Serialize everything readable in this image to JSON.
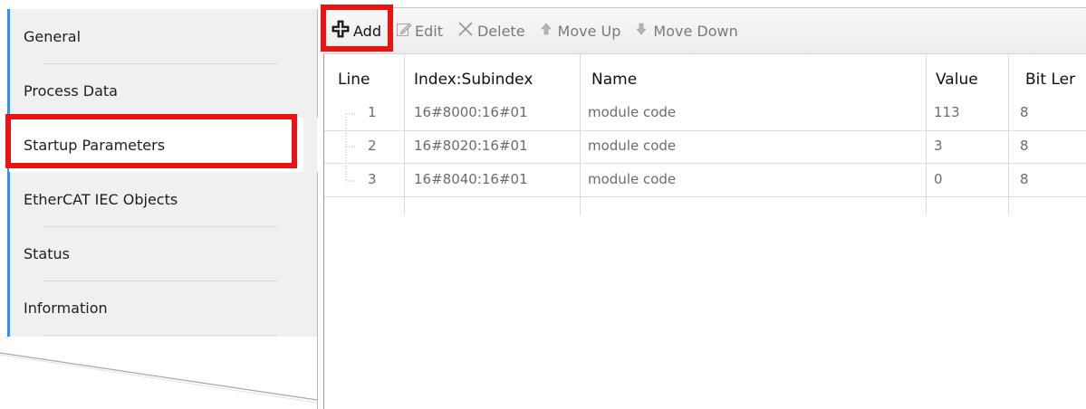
{
  "sidebar": {
    "items": [
      {
        "label": "General"
      },
      {
        "label": "Process Data"
      },
      {
        "label": "Startup Parameters"
      },
      {
        "label": "EtherCAT IEC Objects"
      },
      {
        "label": "Status"
      },
      {
        "label": "Information"
      }
    ],
    "active_index": 2
  },
  "toolbar": {
    "add_label": "Add",
    "edit_label": "Edit",
    "delete_label": "Delete",
    "move_up_label": "Move Up",
    "move_down_label": "Move Down"
  },
  "table": {
    "headers": [
      "Line",
      "Index:Subindex",
      "Name",
      "Value",
      "Bit Ler"
    ],
    "rows": [
      {
        "line": "1",
        "index": "16#8000:16#01",
        "name": "module code",
        "value": "113",
        "bitlen": "8"
      },
      {
        "line": "2",
        "index": "16#8020:16#01",
        "name": "module code",
        "value": "3",
        "bitlen": "8"
      },
      {
        "line": "3",
        "index": "16#8040:16#01",
        "name": "module code",
        "value": "0",
        "bitlen": "8"
      }
    ]
  },
  "colors": {
    "highlight": "#ee1111",
    "sidebar_accent": "#3d8ee6",
    "add_icon": "#2a2a2a"
  },
  "icons": {
    "add": "plus-icon",
    "edit": "pencil-icon",
    "delete": "x-icon",
    "move_up": "arrow-up-icon",
    "move_down": "arrow-down-icon"
  }
}
